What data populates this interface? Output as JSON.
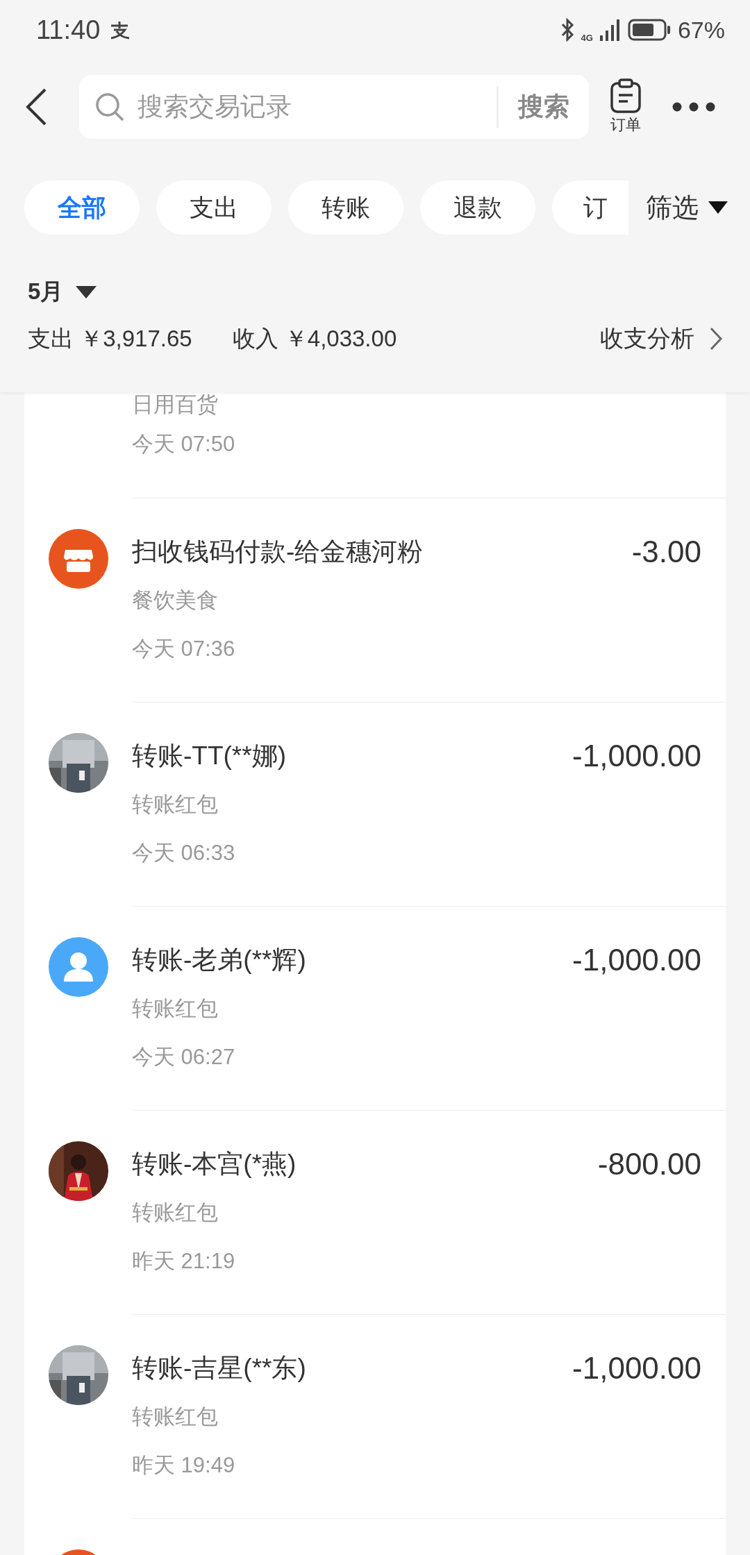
{
  "status_bar": {
    "time": "11:40",
    "network": "4G",
    "battery": "67%"
  },
  "header": {
    "search": {
      "placeholder": "搜索交易记录",
      "button": "搜索"
    },
    "order_label": "订单"
  },
  "filters": [
    {
      "label": "全部",
      "selected": true
    },
    {
      "label": "支出",
      "selected": false
    },
    {
      "label": "转账",
      "selected": false
    },
    {
      "label": "退款",
      "selected": false
    },
    {
      "label": "订",
      "selected": false
    }
  ],
  "filter_button": "筛选",
  "summary": {
    "month": "5月",
    "expense": "支出 ￥3,917.65",
    "income": "收入 ￥4,033.00",
    "analysis": "收支分析"
  },
  "transactions": [
    {
      "category": "日用百货",
      "time": "今天 07:50"
    },
    {
      "kind": "shop",
      "title": "扫收钱码付款-给金穗河粉",
      "amount": "-3.00",
      "category": "餐饮美食",
      "time": "今天 07:36"
    },
    {
      "title": "转账-TT(**娜)",
      "amount": "-1,000.00",
      "category": "转账红包",
      "time": "今天 06:33"
    },
    {
      "kind": "person",
      "title": "转账-老弟(**辉)",
      "amount": "-1,000.00",
      "category": "转账红包",
      "time": "今天 06:27"
    },
    {
      "title": "转账-本宫(*燕)",
      "amount": "-800.00",
      "category": "转账红包",
      "time": "昨天 21:19"
    },
    {
      "title": "转账-吉星(**东)",
      "amount": "-1,000.00",
      "category": "转账红包",
      "time": "昨天 19:49"
    },
    {
      "kind": "shop"
    }
  ]
}
